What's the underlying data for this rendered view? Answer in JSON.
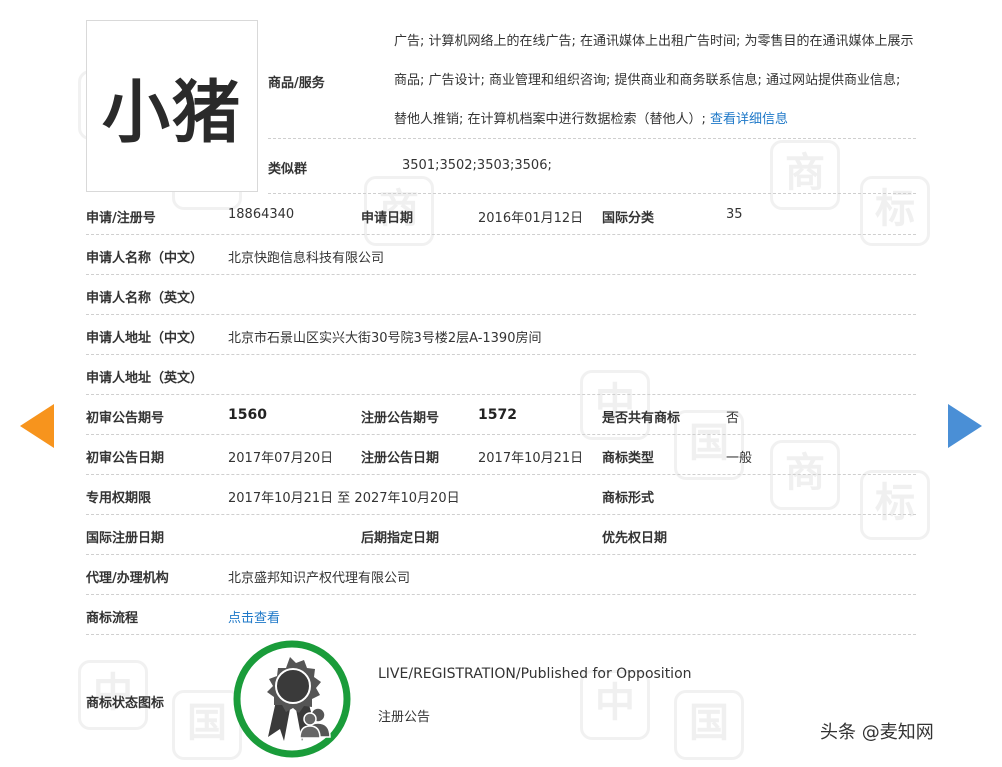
{
  "logo": {
    "text": "小猪"
  },
  "goods": {
    "label": "商品/服务",
    "text": "广告; 计算机网络上的在线广告; 在通讯媒体上出租广告时间; 为零售目的在通讯媒体上展示商品; 广告设计; 商业管理和组织咨询; 提供商业和商务联系信息; 通过网站提供商业信息; 替他人推销; 在计算机档案中进行数据检索（替他人）; ",
    "detail_link": "查看详细信息"
  },
  "similar": {
    "label": "类似群",
    "value": "3501;3502;3503;3506;"
  },
  "rows": {
    "r1": {
      "l1": "申请/注册号",
      "v1": "18864340",
      "l2": "申请日期",
      "v2": "2016年01月12日",
      "l3": "国际分类",
      "v3": "35"
    },
    "r2": {
      "l1": "申请人名称（中文）",
      "v1": "北京快跑信息科技有限公司"
    },
    "r3": {
      "l1": "申请人名称（英文）",
      "v1": ""
    },
    "r4": {
      "l1": "申请人地址（中文）",
      "v1": "北京市石景山区实兴大街30号院3号楼2层A-1390房间"
    },
    "r5": {
      "l1": "申请人地址（英文）",
      "v1": ""
    },
    "r6": {
      "l1": "初审公告期号",
      "v1": "1560",
      "l2": "注册公告期号",
      "v2": "1572",
      "l3": "是否共有商标",
      "v3": "否"
    },
    "r7": {
      "l1": "初审公告日期",
      "v1": "2017年07月20日",
      "l2": "注册公告日期",
      "v2": "2017年10月21日",
      "l3": "商标类型",
      "v3": "一般"
    },
    "r8": {
      "l1": "专用权期限",
      "v1": "2017年10月21日 至 2027年10月20日",
      "l3": "商标形式",
      "v3": ""
    },
    "r9": {
      "l1": "国际注册日期",
      "l2": "后期指定日期",
      "l3": "优先权日期"
    },
    "r10": {
      "l1": "代理/办理机构",
      "v1": "北京盛邦知识产权代理有限公司"
    },
    "r11": {
      "l1": "商标流程",
      "v1": "点击查看"
    }
  },
  "status": {
    "label": "商标状态图标",
    "en": "LIVE/REGISTRATION/Published for Opposition",
    "cn": "注册公告"
  },
  "watermark": {
    "text": "头条 @麦知网"
  },
  "colors": {
    "badge_ring": "#1a9c3a",
    "link": "#1e78c8",
    "arrow_left": "#f7941d",
    "arrow_right": "#4a8fd6"
  }
}
